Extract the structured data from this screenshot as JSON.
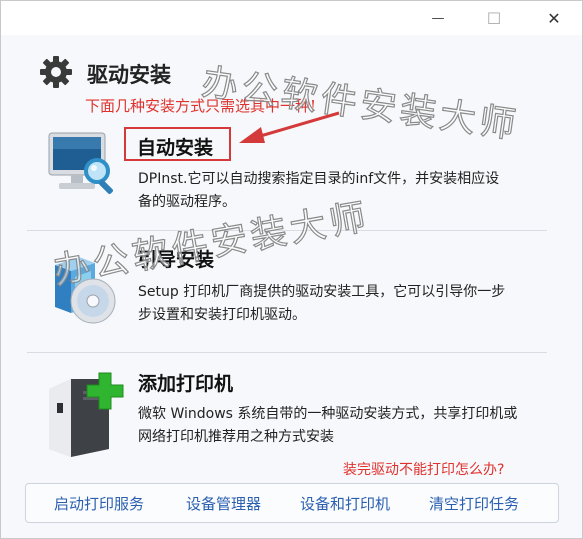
{
  "window": {
    "controls": {
      "minimize": "—",
      "maximize": "☐",
      "close": "✕"
    }
  },
  "header": {
    "title": "驱动安装",
    "hint": "下面几种安装方式只需选其中一种!"
  },
  "options": [
    {
      "title": "自动安装",
      "description": "DPInst.它可以自动搜索指定目录的inf文件，并安装相应设备的驱动程序。"
    },
    {
      "title": "引导安装",
      "description": "Setup 打印机厂商提供的驱动安装工具，它可以引导你一步步设置和安装打印机驱动。"
    },
    {
      "title": "添加打印机",
      "description": "微软 Windows 系统自带的一种驱动安装方式，共享打印机或网络打印机推荐用之种方式安装"
    }
  ],
  "help_link": "装完驱动不能打印怎么办?",
  "bottom_links": [
    "启动打印服务",
    "设备管理器",
    "设备和打印机",
    "清空打印任务"
  ],
  "watermark": "办公软件安装大师",
  "colors": {
    "hint_red": "#e0322d",
    "highlight_border": "#d43a3a",
    "link_blue": "#2a5fb0",
    "plus_green": "#2fb52f"
  }
}
